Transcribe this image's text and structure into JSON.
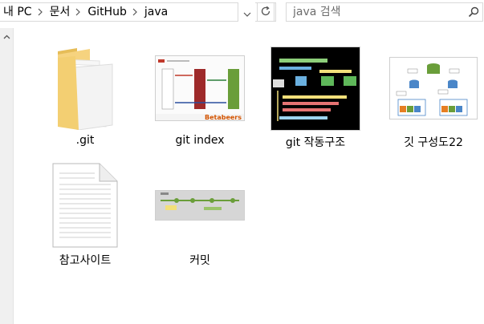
{
  "address_bar": {
    "breadcrumbs": [
      "내 PC",
      "문서",
      "GitHub",
      "java"
    ],
    "dropdown_icon": "chevron-down-icon",
    "refresh_icon": "refresh-icon"
  },
  "search": {
    "placeholder": "java 검색",
    "icon": "search-icon"
  },
  "items": [
    {
      "name": ".git",
      "type": "folder"
    },
    {
      "name": "git index",
      "type": "image"
    },
    {
      "name": "git 작동구조",
      "type": "image"
    },
    {
      "name": "깃 구성도22",
      "type": "image"
    },
    {
      "name": "참고사이트",
      "type": "document"
    },
    {
      "name": "커밋",
      "type": "image"
    }
  ],
  "thumbnails": {
    "git_index": {
      "brand_text": "Betabeers"
    }
  },
  "colors": {
    "folder": "#f5d37c",
    "accent_red": "#9e2a2a",
    "accent_green": "#6a9e3a"
  }
}
